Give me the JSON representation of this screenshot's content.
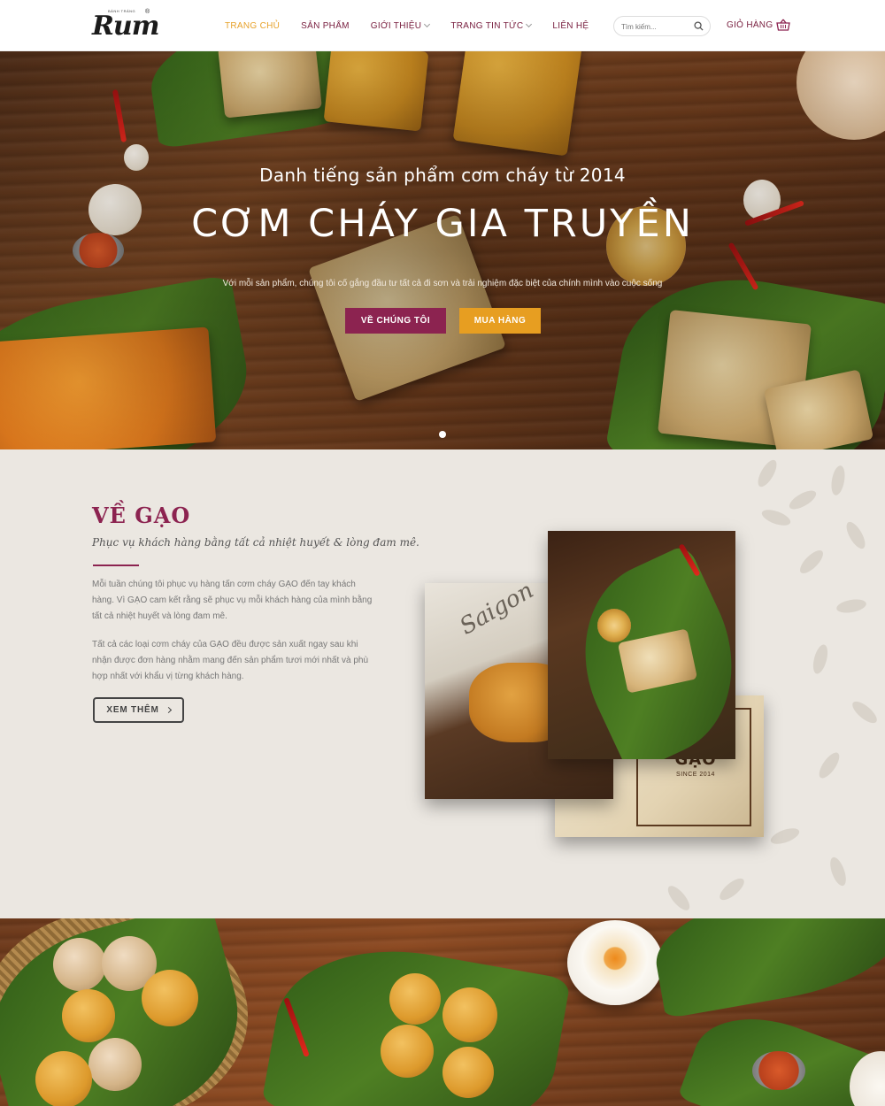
{
  "header": {
    "logo": {
      "name": "Rum",
      "tagline": "BÁNH TRÁNG",
      "mark": "®"
    },
    "nav": [
      {
        "label": "TRANG CHỦ",
        "active": true,
        "has_dropdown": false
      },
      {
        "label": "SẢN PHẨM",
        "active": false,
        "has_dropdown": false
      },
      {
        "label": "GIỚI THIỆU",
        "active": false,
        "has_dropdown": true
      },
      {
        "label": "TRANG TIN TỨC",
        "active": false,
        "has_dropdown": true
      },
      {
        "label": "LIÊN HỆ",
        "active": false,
        "has_dropdown": false
      }
    ],
    "search": {
      "placeholder": "Tìm kiếm...",
      "icon": "search-icon"
    },
    "cart": {
      "label": "GIỎ HÀNG",
      "icon": "basket-icon"
    }
  },
  "hero": {
    "subtitle": "Danh tiếng sản phẩm cơm cháy từ 2014",
    "title": "CƠM CHÁY GIA TRUYỀN",
    "description": "Với mỗi sản phẩm, chúng tôi cố gắng đầu tư tất cả đi sơn và trải nghiệm đặc biệt của chính mình vào cuộc sống",
    "primary_button": "VỀ CHÚNG TÔI",
    "secondary_button": "MUA HÀNG",
    "slide_count": 1,
    "active_slide": 1
  },
  "about": {
    "title": "VỀ GẠO",
    "tagline": "Phục vụ khách hàng bằng tất cả nhiệt huyết & lòng đam mê.",
    "paragraphs": [
      "Mỗi tuần chúng tôi phục vụ hàng tấn cơm cháy GẠO đến tay khách hàng. Vì GẠO cam kết rằng sẽ phục vụ mỗi khách hàng của mình bằng tất cả nhiệt huyết và lòng đam mê.",
      "Tất cả các loại cơm cháy của GẠO đều được sản xuất ngay sau khi nhận được đơn hàng nhằm mang đến sản phẩm tươi mới nhất và phù hợp nhất với khẩu vị từng khách hàng."
    ],
    "button": "XEM THÊM",
    "images": {
      "newspaper_text": "Saigon",
      "brand_word": "GẠO",
      "brand_since": "SINCE 2014"
    }
  },
  "colors": {
    "brand": "#8c2350",
    "accent": "#e79e21",
    "nav_active": "#e7a22b",
    "about_bg": "#ebe7e1"
  }
}
